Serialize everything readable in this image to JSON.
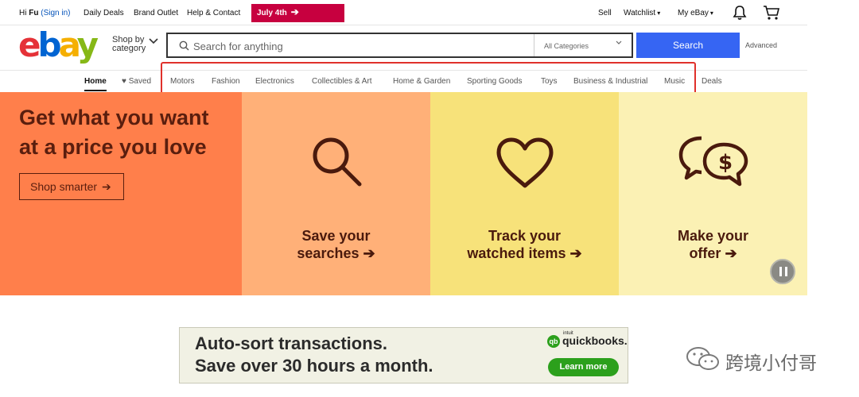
{
  "topbar": {
    "greeting_prefix": "Hi ",
    "user_name": "Fu",
    "sign_in": "(Sign in)",
    "links": [
      "Daily Deals",
      "Brand Outlet",
      "Help & Contact"
    ],
    "promo_label": "July 4th",
    "sell": "Sell",
    "watchlist": "Watchlist",
    "my_ebay": "My eBay",
    "promo_color": "#c7003f"
  },
  "header": {
    "logo_letters": [
      "e",
      "b",
      "a",
      "y"
    ],
    "shop_by_line1": "Shop by",
    "shop_by_line2": "category",
    "search_placeholder": "Search for anything",
    "category_select": "All Categories",
    "search_button": "Search",
    "advanced": "Advanced",
    "accent_color": "#3665f3"
  },
  "nav": {
    "home": "Home",
    "saved": "Saved",
    "categories": [
      "Motors",
      "Fashion",
      "Electronics",
      "Collectibles & Art",
      "Home & Garden",
      "Sporting Goods",
      "Toys",
      "Business & Industrial",
      "Music"
    ],
    "deals": "Deals"
  },
  "hero": {
    "title_line1": "Get what you want",
    "title_line2": "at a price you love",
    "cta": "Shop smarter",
    "panels": [
      {
        "line1": "Save your",
        "line2": "searches",
        "icon": "magnifier-icon"
      },
      {
        "line1": "Track your",
        "line2": "watched items",
        "icon": "heart-icon"
      },
      {
        "line1": "Make your",
        "line2": "offer",
        "icon": "chat-dollar-icon"
      }
    ],
    "colors": [
      "#ff7f4b",
      "#ffb078",
      "#f7e27a",
      "#fbf1b4"
    ]
  },
  "ad": {
    "line1": "Auto-sort transactions.",
    "line2": "Save over 30 hours a month.",
    "brand_small": "intuit",
    "brand": "quickbooks.",
    "button": "Learn more"
  },
  "watermark": {
    "text": "跨境小付哥"
  }
}
